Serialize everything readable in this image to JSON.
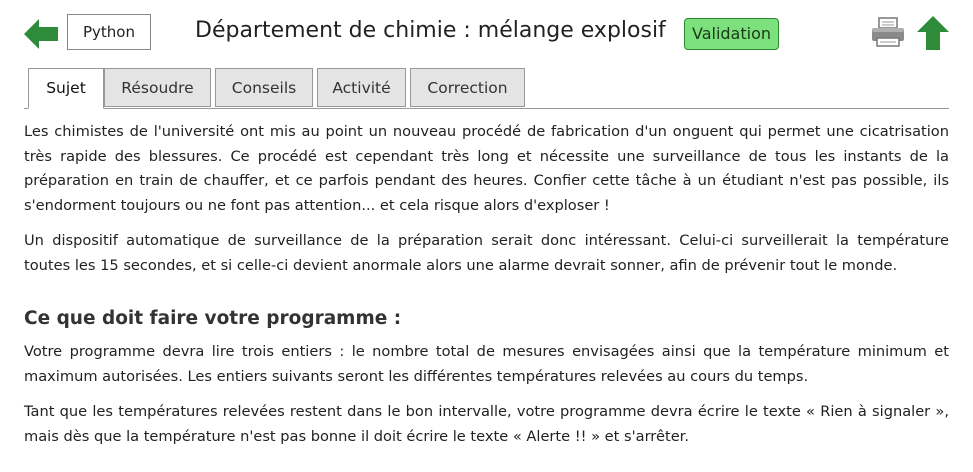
{
  "header": {
    "language_button": "Python",
    "title": "Département de chimie : mélange explosif",
    "validation_badge": "Validation",
    "colors": {
      "arrow_green": "#2e8b3a",
      "validation_bg": "#7ce07c"
    },
    "icons": [
      "back-arrow-icon",
      "printer-icon",
      "up-arrow-icon"
    ]
  },
  "tabs": [
    {
      "label": "Sujet",
      "active": true
    },
    {
      "label": "Résoudre",
      "active": false
    },
    {
      "label": "Conseils",
      "active": false
    },
    {
      "label": "Activité",
      "active": false
    },
    {
      "label": "Correction",
      "active": false
    }
  ],
  "content": {
    "paragraph_1": "Les chimistes de l'université ont mis au point un nouveau procédé de fabrication d'un onguent qui permet une cicatrisation très rapide des blessures. Ce procédé est cependant très long et nécessite une surveillance de tous les instants de la préparation en train de chauffer, et ce parfois pendant des heures. Confier cette tâche à un étudiant n'est pas possible, ils s'endorment toujours ou ne font pas attention... et cela risque alors d'exploser !",
    "paragraph_2": "Un dispositif automatique de surveillance de la préparation serait donc intéressant. Celui-ci surveillerait la température toutes les 15 secondes, et si celle-ci devient anormale alors une alarme devrait sonner, afin de prévenir tout le monde.",
    "section_heading": "Ce que doit faire votre programme :",
    "paragraph_3": "Votre programme devra lire trois entiers : le nombre total de mesures envisagées ainsi que la température minimum et maximum autorisées. Les entiers suivants seront les différentes températures relevées au cours du temps.",
    "paragraph_4": "Tant que les températures relevées restent dans le bon intervalle, votre programme devra écrire le texte « Rien à signaler », mais dès que la température n'est pas bonne il doit écrire le texte « Alerte !! » et s'arrêter."
  }
}
